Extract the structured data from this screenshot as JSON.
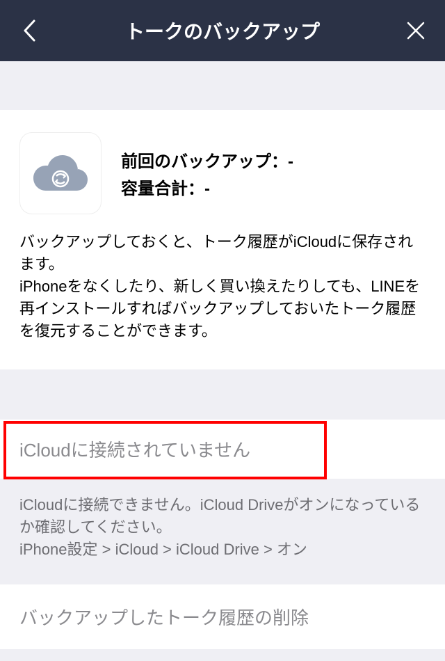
{
  "header": {
    "title": "トークのバックアップ"
  },
  "backup": {
    "last_label": "前回のバックアップ：-",
    "size_label": "容量合計：-"
  },
  "description": {
    "text": "バックアップしておくと、トーク履歴がiCloudに保存されます。\niPhoneをなくしたり、新しく買い換えたりしても、LINEを再インストールすればバックアップしておいたトーク履歴を復元することができます。"
  },
  "status": {
    "title": "iCloudに接続されていません"
  },
  "hint": {
    "text": "iCloudに接続できません。iCloud Driveがオンになっているか確認してください。\niPhone設定 > iCloud > iCloud Drive > オン"
  },
  "delete": {
    "label": "バックアップしたトーク履歴の削除"
  }
}
